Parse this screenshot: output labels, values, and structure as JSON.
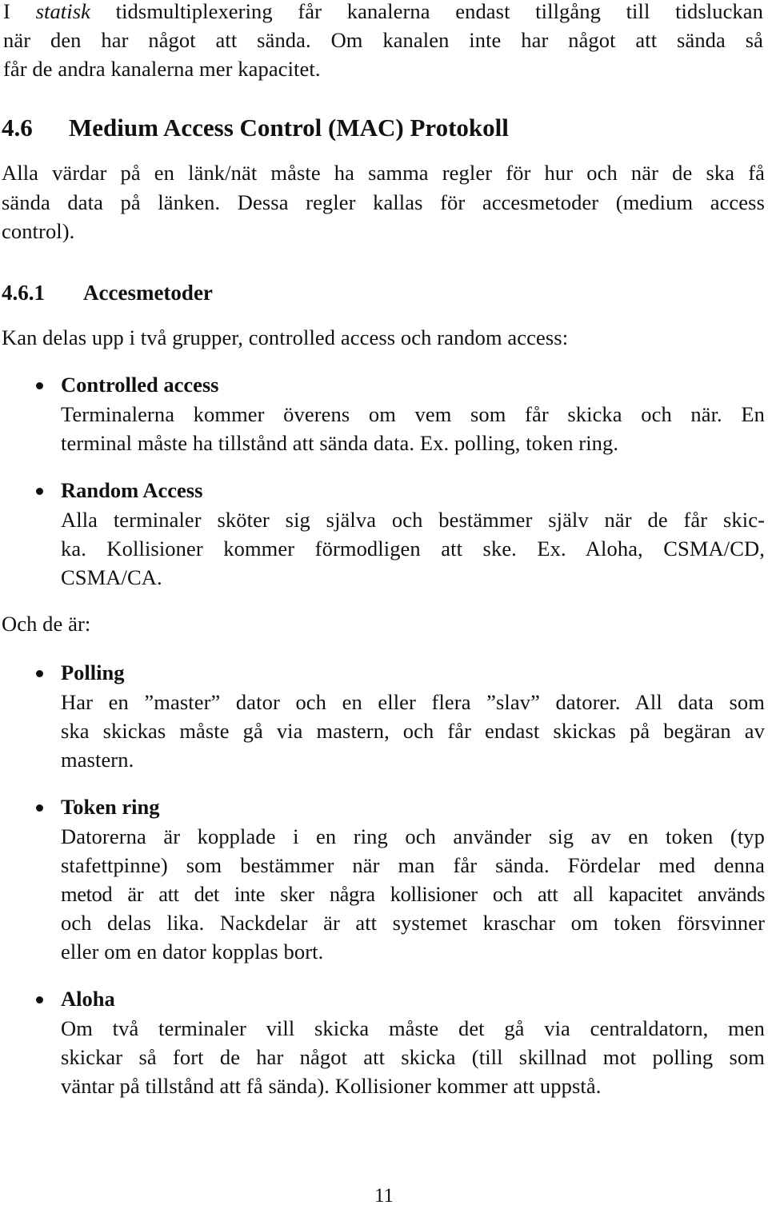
{
  "intro": {
    "lines": [
      {
        "prefix": "I ",
        "emph": "statisk",
        "rest": " tidsmultiplexering får kanalerna endast tillgång till tidsluckan"
      },
      {
        "text": "när den har något att sända. Om kanalen inte har något att sända så"
      },
      {
        "text": "får de andra kanalerna mer kapacitet."
      }
    ]
  },
  "section": {
    "number": "4.6",
    "title": "Medium Access Control (MAC) Protokoll",
    "lines": [
      "Alla värdar på en länk/nät måste ha samma regler för hur och när de ska få",
      "sända data på länken. Dessa regler kallas för accesmetoder (medium access",
      "control)."
    ]
  },
  "subsection": {
    "number": "4.6.1",
    "title": "Accesmetoder",
    "lead": "Kan delas upp i två grupper, controlled access och random access:"
  },
  "groups": [
    {
      "title": "Controlled access",
      "lines": [
        "Terminalerna kommer överens om vem som får skicka och när. En",
        "terminal måste ha tillstånd att sända data. Ex. polling, token ring."
      ]
    },
    {
      "title": "Random Access",
      "lines": [
        "Alla terminaler sköter sig själva och bestämmer själv när de får skic-",
        "ka. Kollisioner kommer förmodligen att ske. Ex. Aloha, CSMA/CD,",
        "CSMA/CA."
      ]
    }
  ],
  "methods_lead": "Och de är:",
  "methods": [
    {
      "title": "Polling",
      "lines": [
        "Har en ”master” dator och en eller flera ”slav” datorer. All data som",
        "ska skickas måste gå via mastern, och får endast skickas på begäran av",
        "mastern."
      ]
    },
    {
      "title": "Token ring",
      "lines": [
        "Datorerna är kopplade i en ring och använder sig av en token (typ",
        "stafettpinne) som bestämmer när man får sända. Fördelar med denna",
        "metod är att det inte sker några kollisioner och att all kapacitet används",
        "och delas lika. Nackdelar är att systemet kraschar om token försvinner",
        "eller om en dator kopplas bort."
      ]
    },
    {
      "title": "Aloha",
      "lines": [
        "Om två terminaler vill skicka måste det gå via centraldatorn, men",
        "skickar så fort de har något att skicka (till skillnad mot polling som",
        "väntar på tillstånd att få sända). Kollisioner kommer att uppstå."
      ]
    }
  ],
  "page_number": "11"
}
